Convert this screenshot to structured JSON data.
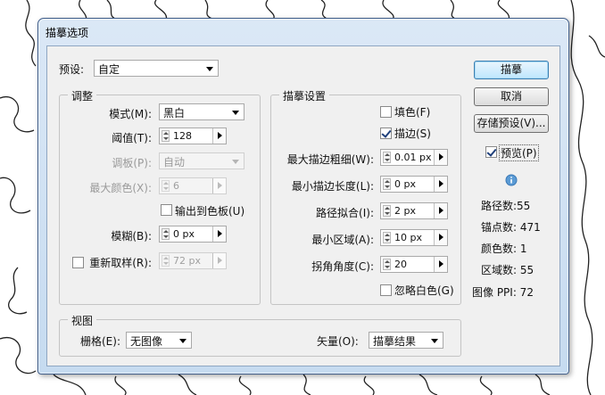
{
  "dialog": {
    "title": "描摹选项",
    "preset": {
      "label": "预设:",
      "value": "自定"
    },
    "adjust": {
      "legend": "调整",
      "mode": {
        "label": "模式(M):",
        "value": "黑白"
      },
      "threshold": {
        "label": "阈值(T):",
        "value": "128"
      },
      "palette": {
        "label": "调板(P):",
        "value": "自动"
      },
      "max_colors": {
        "label": "最大颜色(X):",
        "value": "6"
      },
      "output_swatches": {
        "label": "输出到色板(U)",
        "checked": false
      },
      "blur": {
        "label": "模糊(B):",
        "value": "0 px"
      },
      "resample": {
        "label": "重新取样(R):",
        "value": "72 px",
        "checked": false
      }
    },
    "trace": {
      "legend": "描摹设置",
      "fill": {
        "label": "填色(F)",
        "checked": false
      },
      "stroke": {
        "label": "描边(S)",
        "checked": true
      },
      "max_stroke_weight": {
        "label": "最大描边粗细(W):",
        "value": "0.01 px"
      },
      "min_stroke_length": {
        "label": "最小描边长度(L):",
        "value": "0 px"
      },
      "path_fitting": {
        "label": "路径拟合(I):",
        "value": "2 px"
      },
      "min_area": {
        "label": "最小区域(A):",
        "value": "10 px"
      },
      "corner_angle": {
        "label": "拐角角度(C):",
        "value": "20"
      },
      "ignore_white": {
        "label": "忽略白色(G)",
        "checked": false
      }
    },
    "view": {
      "legend": "视图",
      "raster": {
        "label": "栅格(E):",
        "value": "无图像"
      },
      "vector": {
        "label": "矢量(O):",
        "value": "描摹结果"
      }
    },
    "buttons": {
      "trace": "描摹",
      "cancel": "取消",
      "save_preset": "存储预设(V)..."
    },
    "preview": {
      "label": "预览(P)",
      "checked": true
    },
    "stats": {
      "paths": "路径数:55",
      "anchors": "锚点数: 471",
      "colors": "颜色数: 1",
      "areas": "区域数: 55",
      "image_ppi": "图像 PPI: 72"
    }
  },
  "colors": {
    "title_bar": "#c6dbf0",
    "default_button": "#bee6fd",
    "frame": "#3e5d8a"
  }
}
